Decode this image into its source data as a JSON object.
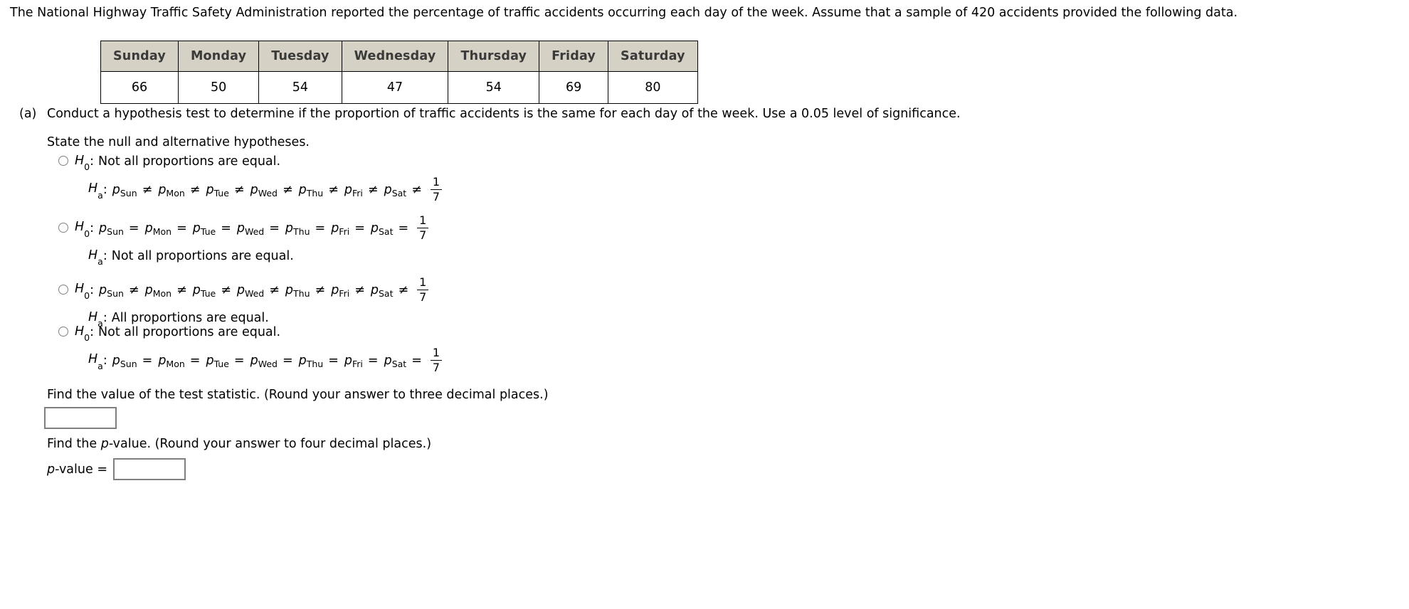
{
  "intro": {
    "text": "The National Highway Traffic Safety Administration reported the percentage of traffic accidents occurring each day of the week. Assume that a sample of 420 accidents provided the following data."
  },
  "table": {
    "headers": [
      "Sunday",
      "Monday",
      "Tuesday",
      "Wednesday",
      "Thursday",
      "Friday",
      "Saturday"
    ],
    "values": [
      "66",
      "50",
      "54",
      "47",
      "54",
      "69",
      "80"
    ]
  },
  "part_a": {
    "marker": "(a)",
    "prompt": "Conduct a hypothesis test to determine if the proportion of traffic accidents is the same for each day of the week. Use a 0.05 level of significance.",
    "state_line": "State the null and alternative hypotheses."
  },
  "symbols": {
    "H": "H",
    "sub_null": "0",
    "sub_alt": "a",
    "colon": ":",
    "p": "p",
    "ne": "≠",
    "eq": "=",
    "frac_num": "1",
    "frac_den": "7",
    "days_sub": [
      "Sun",
      "Mon",
      "Tue",
      "Wed",
      "Thu",
      "Fri",
      "Sat"
    ]
  },
  "options": [
    {
      "id": "option-1",
      "line1": {
        "h": "H",
        "sub": "0",
        "kind": "text",
        "text": "Not all proportions are equal."
      },
      "line2": {
        "h": "H",
        "sub": "a",
        "kind": "chain",
        "op": "≠"
      }
    },
    {
      "id": "option-2",
      "line1": {
        "h": "H",
        "sub": "0",
        "kind": "chain",
        "op": "="
      },
      "line2": {
        "h": "H",
        "sub": "a",
        "kind": "text",
        "text": "Not all proportions are equal."
      }
    },
    {
      "id": "option-3",
      "line1": {
        "h": "H",
        "sub": "0",
        "kind": "chain",
        "op": "≠"
      },
      "line2": {
        "h": "H",
        "sub": "a",
        "kind": "text",
        "text": "All proportions are equal."
      }
    },
    {
      "id": "option-4",
      "line1": {
        "h": "H",
        "sub": "0",
        "kind": "text",
        "text": "Not all proportions are equal."
      },
      "line2": {
        "h": "H",
        "sub": "a",
        "kind": "chain",
        "op": "="
      }
    }
  ],
  "test_statistic": {
    "question": "Find the value of the test statistic. (Round your answer to three decimal places.)",
    "value": "",
    "placeholder": ""
  },
  "p_value": {
    "question_prefix": "Find the ",
    "question_italic": "p",
    "question_suffix": "-value. (Round your answer to four decimal places.)",
    "label_italic": "p",
    "label_rest": "-value =",
    "value": "",
    "placeholder": ""
  },
  "colors": {
    "table_header_bg": "#d6d1c5",
    "table_border": "#000000",
    "input_border": "#7f7f7f",
    "radio_border": "#808080",
    "text": "#000000"
  }
}
